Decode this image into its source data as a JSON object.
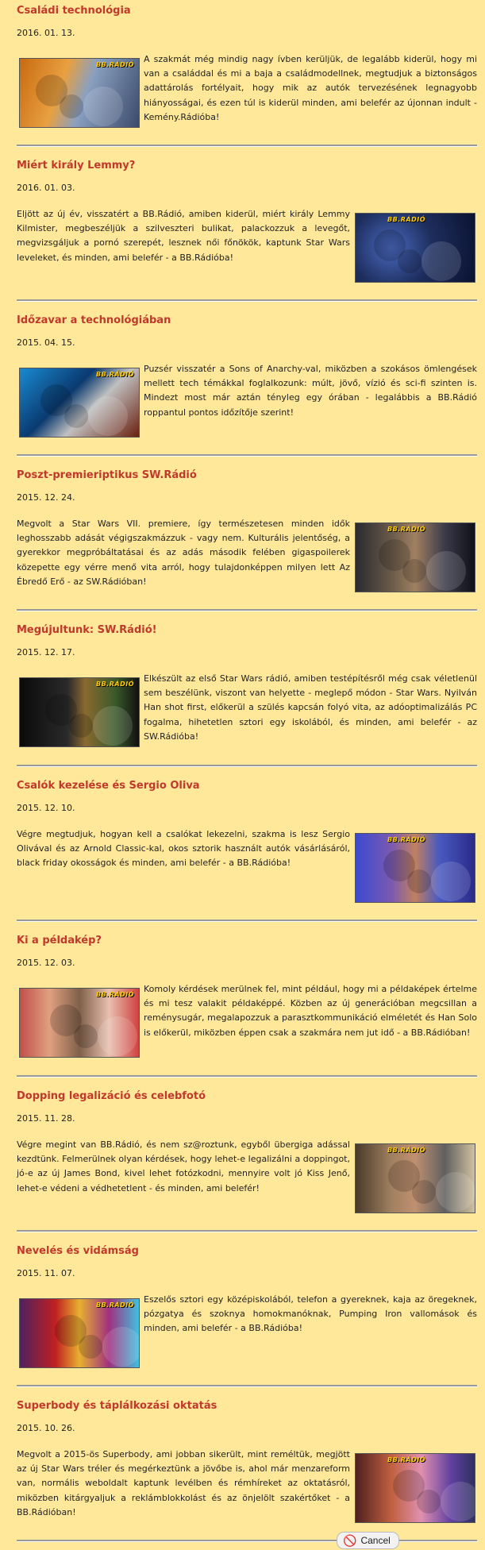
{
  "brand_badge": "BB.RÁDIÓ",
  "posts": [
    {
      "title": "Családi technológia",
      "date": "2016. 01. 13.",
      "text": "A szakmát még mindig nagy ívben kerüljük, de legalább kiderül, hogy mi van a családdal és mi a baja a családmodellnek, megtudjuk a biztonságos adattárolás fortélyait, hogy mik az autók tervezésének legnagyobb hiányosságai, és ezen túl is kiderül minden, ami belefér az újonnan indult - Kemény.Rádióba!",
      "image_side": "left"
    },
    {
      "title": "Miért király Lemmy?",
      "date": "2016. 01. 03.",
      "text": "Eljött az új év, visszatért a BB.Rádió, amiben kiderül, miért király Lemmy Kilmister, megbeszéljük a szilveszteri bulikat, palackozzuk a levegőt, megvizsgáljuk a pornó szerepét, lesznek női főnökök, kaptunk Star Wars leveleket, és minden, ami belefér - a BB.Rádióba!",
      "image_side": "right"
    },
    {
      "title": "Időzavar a technológiában",
      "date": "2015. 04. 15.",
      "text": "Puzsér visszatér a Sons of Anarchy-val, miközben a szokásos ömlengések mellett tech témákkal foglalkozunk: múlt, jövő, vízió és sci-fi szinten is. Mindezt most már aztán tényleg egy órában - legalábbis a BB.Rádió roppantul pontos időzítője szerint!",
      "image_side": "left"
    },
    {
      "title": "Poszt-premieriptikus SW.Rádió",
      "date": "2015. 12. 24.",
      "text": "Megvolt a Star Wars VII. premiere, így természetesen minden idők leghosszabb adását végigszakmázzuk - vagy nem. Kulturális jelentőség, a gyerekkor megpróbáltatásai és az adás második felében gigaspoilerek közepette egy vérre menő vita arról, hogy tulajdonképpen milyen lett Az Ébredő Erő - az SW.Rádióban!",
      "image_side": "right"
    },
    {
      "title": "Megújultunk: SW.Rádió!",
      "date": "2015. 12. 17.",
      "text": "Elkészült az első Star Wars rádió, amiben testépítésről még csak véletlenül sem beszélünk, viszont van helyette - meglepő módon - Star Wars. Nyilván Han shot first, előkerül a szülés kapcsán folyó vita, az adóoptimalizálás PC fogalma, hihetetlen sztori egy iskolából, és minden, ami belefér - az SW.Rádióba!",
      "image_side": "left"
    },
    {
      "title": "Csalók kezelése és Sergio Oliva",
      "date": "2015. 12. 10.",
      "text": "Végre megtudjuk, hogyan kell a csalókat lekezelni, szakma is lesz Sergio Olivával és az Arnold Classic-kal, okos sztorik használt autók vásárlásáról, black friday okosságok és minden, ami belefér - a BB.Rádióba!",
      "image_side": "right"
    },
    {
      "title": "Ki a példakép?",
      "date": "2015. 12. 03.",
      "text": "Komoly kérdések merülnek fel, mint például, hogy mi a példaképek értelme és mi tesz valakit példaképpé. Közben az új generációban megcsillan a reménysugár, megalapozzuk a parasztkommunikáció elméletét és Han Solo is előkerül, miközben éppen csak a szakmára nem jut idő - a BB.Rádióban!",
      "image_side": "left"
    },
    {
      "title": "Dopping legalizáció és celebfotó",
      "date": "2015. 11. 28.",
      "text": "Végre megint van BB.Rádió, és nem sz@roztunk, egyből übergiga adással kezdtünk. Felmerülnek olyan kérdések, hogy lehet-e legalizálni a doppingot, jó-e az új James Bond, kivel lehet fotózkodni, mennyire volt jó Kiss Jenő, lehet-e védeni a védhetetlent - és minden, ami belefér!",
      "image_side": "right"
    },
    {
      "title": "Nevelés és vidámság",
      "date": "2015. 11. 07.",
      "text": "Eszelős sztori egy középiskolából, telefon a gyereknek, kaja az öregeknek, pózgatya és szoknya homokmanóknak, Pumping Iron vallomások és minden, ami belefér - a BB.Rádióba!",
      "image_side": "left"
    },
    {
      "title": "Superbody és táplálkozási oktatás",
      "date": "2015. 10. 26.",
      "text": "Megvolt a 2015-ös Superbody, ami jobban sikerült, mint reméltük, megjött az új Star Wars tréler és megérkeztünk a jövőbe is, ahol már menzareform van, normális weboldalt kaptunk levélben és rémhíreket az oktatásról, miközben kitárgyaljuk a reklámblokkolást és az önjelölt szakértőket - a BB.Rádióban!",
      "image_side": "right"
    }
  ],
  "cancel_button": {
    "label": "Cancel",
    "icon": "no-entry-icon"
  }
}
